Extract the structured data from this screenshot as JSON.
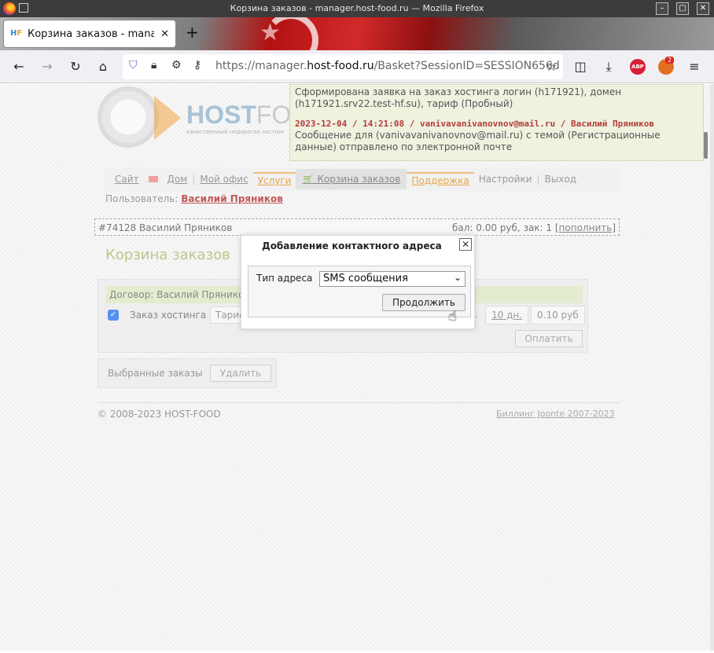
{
  "window": {
    "title": "Корзина заказов - manager.host-food.ru — Mozilla Firefox"
  },
  "tab": {
    "title": "Корзина заказов - manager.host-food.ru",
    "favicon": "hf-logo-icon"
  },
  "navbar": {
    "url_host": "https://manager.",
    "url_domain": "host-food.ru",
    "url_path": "/Basket?SessionID=SESSION656d",
    "extension_badge_count": "2",
    "abp_label": "ABP"
  },
  "site": {
    "logo_main": "HOST",
    "logo_rest": "FOOD",
    "logo_tagline": "качественный недорогой хостинг"
  },
  "notice": {
    "line1": "Сформирована заявка на заказ хостинга логин (h171921), домен (h171921.srv22.test-hf.su), тариф (Пробный)",
    "head2": "2023-12-04 / 14:21:08 / vanivavanivanovnov@mail.ru / Василий Пряников",
    "line2": "Сообщение для (vanivavanivanovnov@mail.ru) с темой (Регистрационные данные) отправлено по электронной почте"
  },
  "menu": {
    "items": [
      "Сайт",
      "Дом",
      "Мой офис",
      "Услуги",
      "Корзина заказов",
      "Поддержка",
      "Настройки",
      "Выход"
    ]
  },
  "user": {
    "label": "Пользователь:",
    "name": "Василий Пряников"
  },
  "account": {
    "id_name": "#74128 Василий Пряников",
    "balance": "бал: 0.00 руб, зак: 1 [",
    "topup": "пополнить",
    "close_bracket": "]"
  },
  "page_title": "Корзина заказов",
  "contract": {
    "label": "Договор: Василий Пряников",
    "order_label": "Заказ хостинга",
    "tariff": "Тариф",
    "dots": "...",
    "period": "10 дн.",
    "price": "0.10 руб",
    "pay_button": "Оплатить"
  },
  "selected": {
    "label": "Выбранные заказы",
    "delete_button": "Удалить"
  },
  "footer": {
    "copyright": "© 2008-2023 HOST-FOOD",
    "billing": "Биллинг Joonte 2007-2023"
  },
  "modal": {
    "title": "Добавление контактного адреса",
    "close": "✕",
    "address_type_label": "Тип адреса",
    "address_type_value": "SMS сообщения",
    "continue_button": "Продолжить"
  }
}
